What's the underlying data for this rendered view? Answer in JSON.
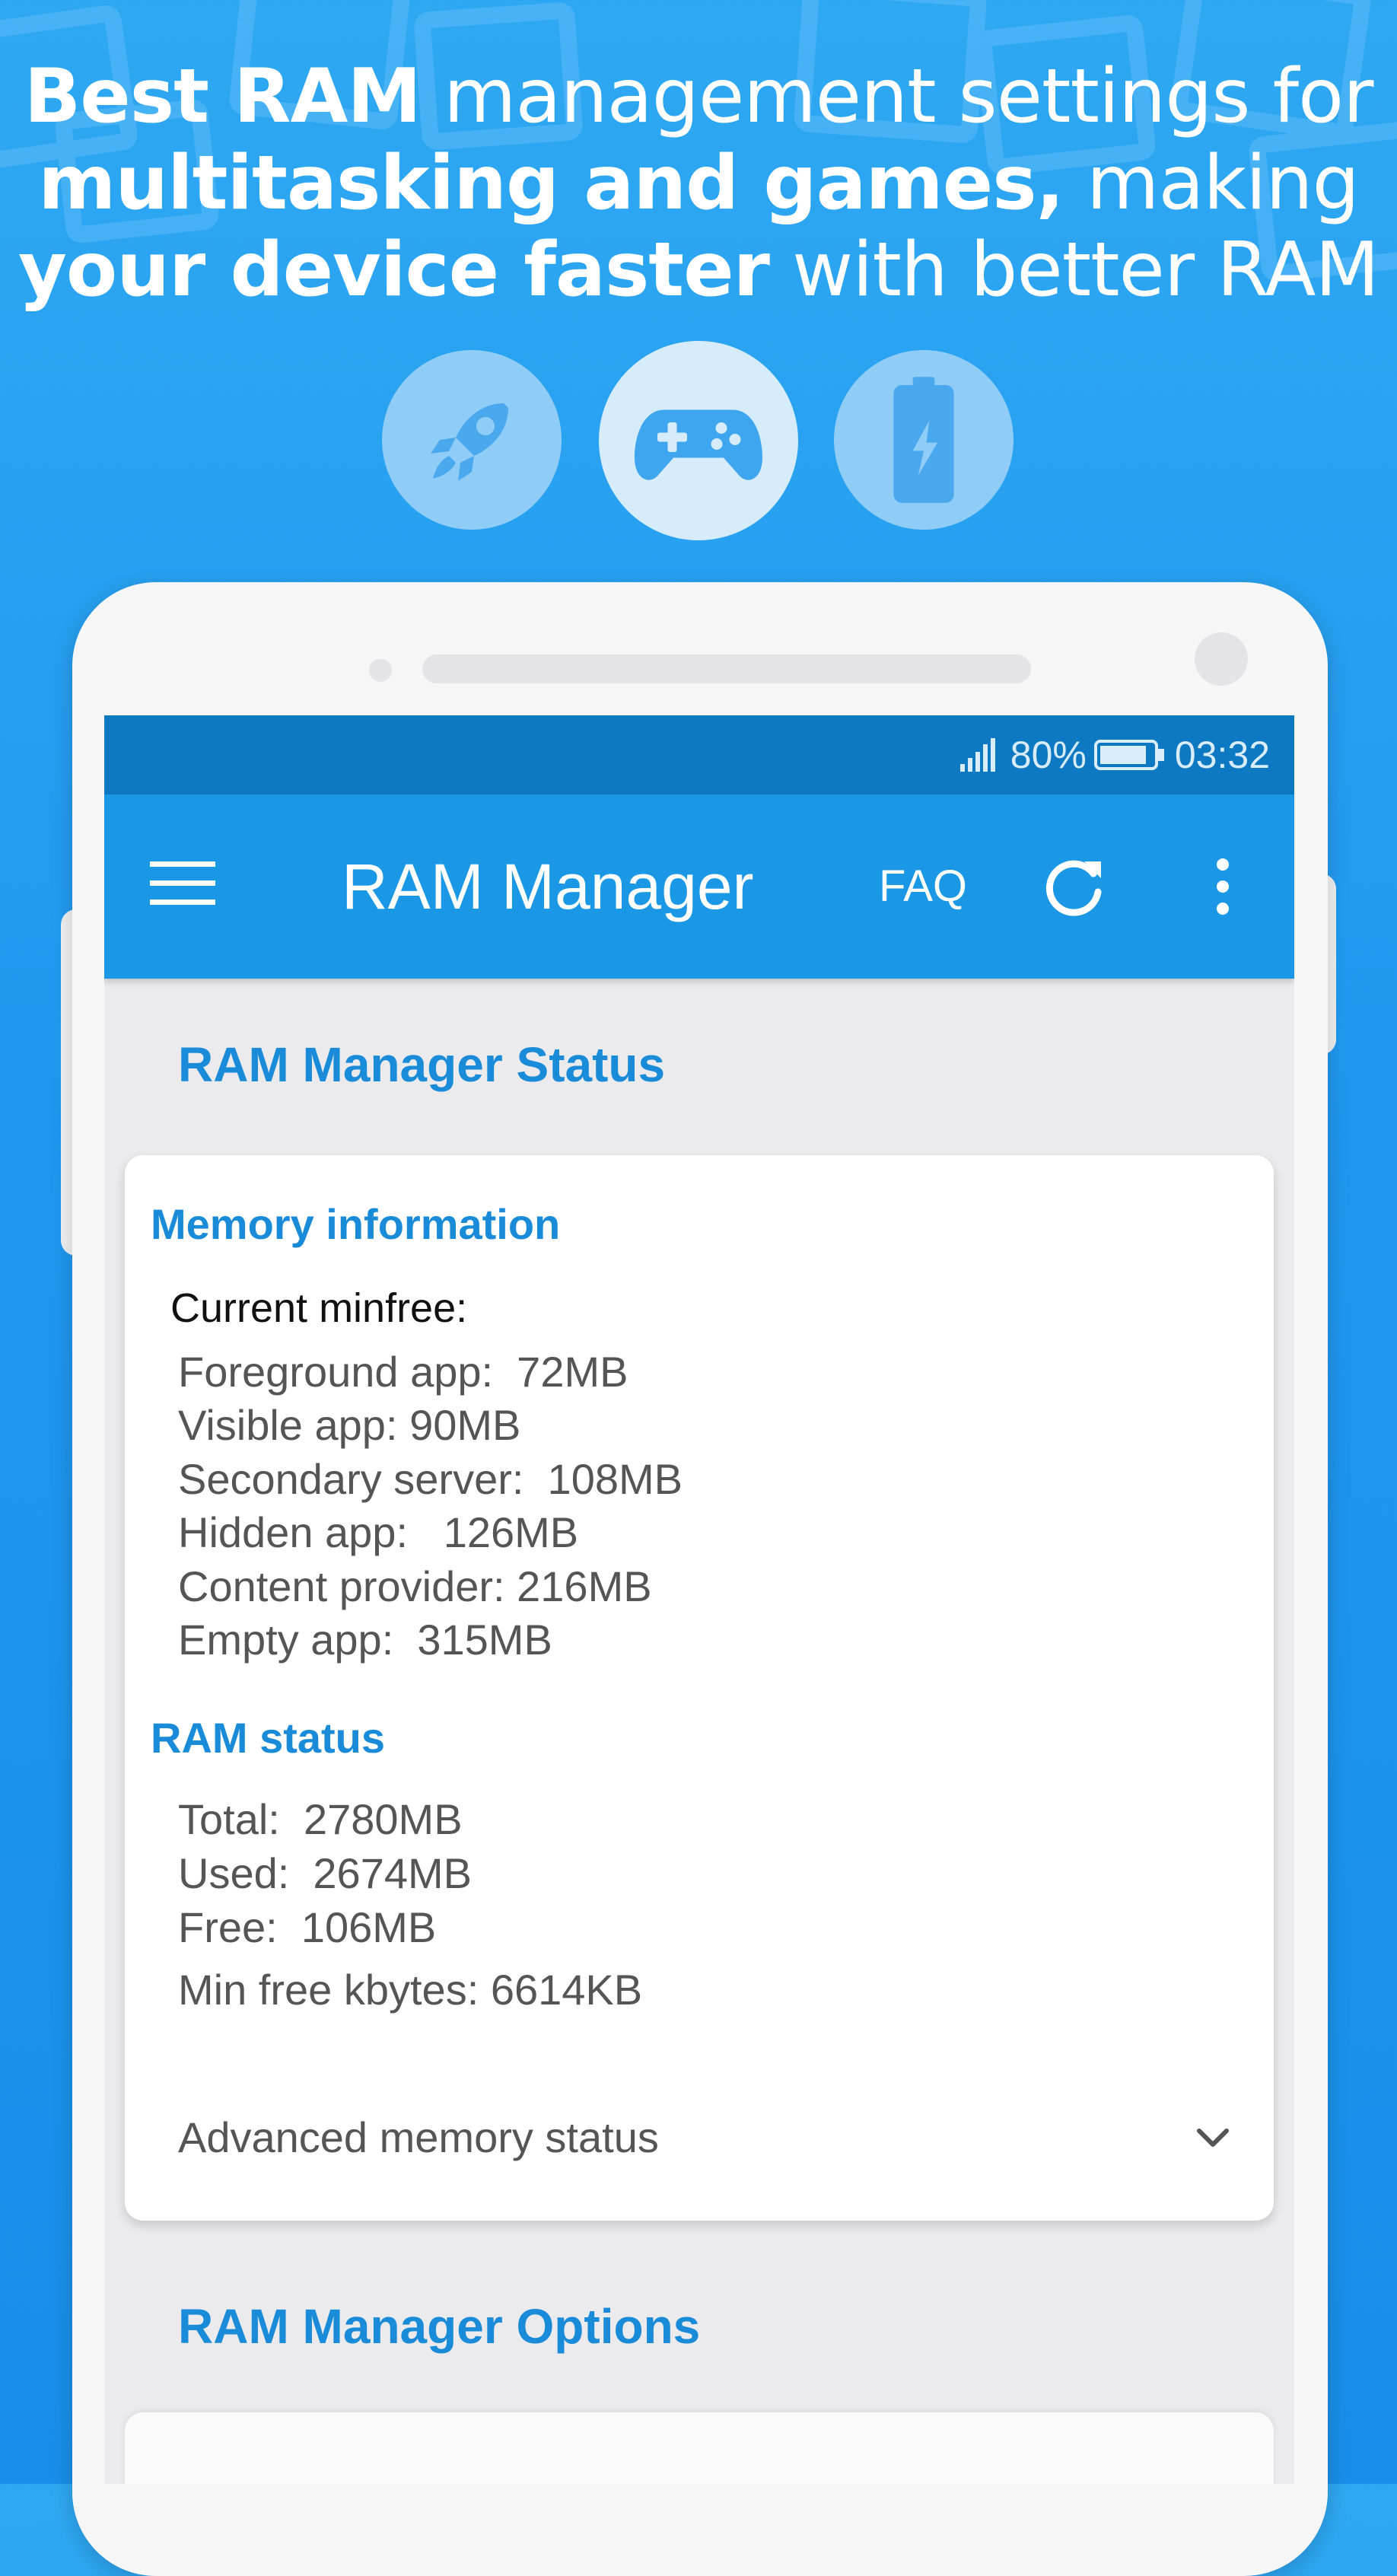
{
  "headline": {
    "line1_bold": "Best RAM",
    "line1_rest": " management settings for",
    "line2_bold": "multitasking and games,",
    "line2_rest": " making",
    "line3_bold": "your device faster",
    "line3_rest": " with better RAM"
  },
  "feature_icons": [
    "rocket-icon",
    "gamepad-icon",
    "battery-icon"
  ],
  "statusbar": {
    "signal": ".ıll",
    "battery": "80%",
    "time": "03:32"
  },
  "appbar": {
    "title": "RAM Manager",
    "faq": "FAQ"
  },
  "status_section": {
    "title": "RAM Manager Status",
    "memory_info_title": "Memory information",
    "current_minfree_label": "Current minfree:",
    "minfree_lines": [
      "Foreground app:  72MB",
      "Visible app: 90MB",
      "Secondary server:  108MB",
      "Hidden app:   126MB",
      "Content provider: 216MB",
      "Empty app:  315MB"
    ],
    "ram_status_title": "RAM status",
    "ram_lines": [
      "Total:  2780MB",
      "Used:  2674MB",
      "Free:  106MB",
      "Min free kbytes: 6614KB"
    ],
    "advanced_label": "Advanced memory status"
  },
  "options_section": {
    "title": "RAM Manager Options"
  },
  "colors": {
    "background": "#2fa8f3",
    "appbar": "#1a98e6",
    "statusbar": "#0c79c2",
    "accent_text": "#1a8bd8"
  }
}
